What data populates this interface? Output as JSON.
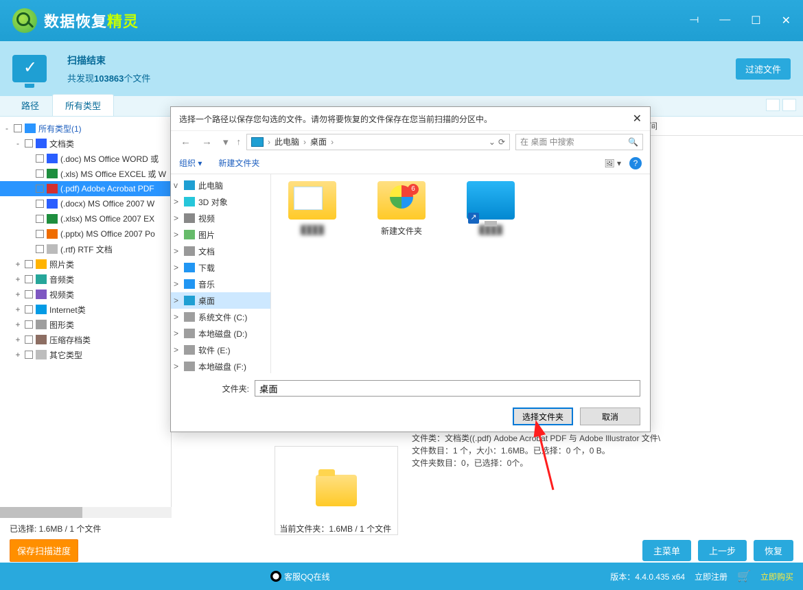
{
  "app": {
    "name_main": "数据恢复",
    "name_accent": "精灵"
  },
  "winctrls": {
    "opt": "⟞",
    "min": "—",
    "max": "☐",
    "close": "✕"
  },
  "scan": {
    "title": "扫描结束",
    "subtitle_prefix": "共发现",
    "count": "103863",
    "subtitle_suffix": "个文件",
    "filter_btn": "过滤文件"
  },
  "tabs": {
    "path": "路径",
    "all": "所有类型"
  },
  "tree": [
    {
      "ind": 0,
      "tw": "-",
      "ic": "ic-all",
      "label": "所有类型(1)",
      "blue": true
    },
    {
      "ind": 1,
      "tw": "-",
      "ic": "ic-docs",
      "label": "文档类"
    },
    {
      "ind": 2,
      "tw": "",
      "ic": "ic-doc",
      "label": "(.doc) MS Office WORD 或"
    },
    {
      "ind": 2,
      "tw": "",
      "ic": "ic-xls",
      "label": "(.xls) MS Office EXCEL 或 W"
    },
    {
      "ind": 2,
      "tw": "",
      "ic": "ic-pdf",
      "label": "(.pdf) Adobe Acrobat PDF",
      "sel": true
    },
    {
      "ind": 2,
      "tw": "",
      "ic": "ic-doc",
      "label": "(.docx) MS Office 2007 W"
    },
    {
      "ind": 2,
      "tw": "",
      "ic": "ic-xls",
      "label": "(.xlsx) MS Office 2007 EX"
    },
    {
      "ind": 2,
      "tw": "",
      "ic": "ic-ppt",
      "label": "(.pptx) MS Office 2007 Po"
    },
    {
      "ind": 2,
      "tw": "",
      "ic": "ic-rtf",
      "label": "(.rtf) RTF 文档"
    },
    {
      "ind": 1,
      "tw": "+",
      "ic": "ic-photo",
      "label": "照片类"
    },
    {
      "ind": 1,
      "tw": "+",
      "ic": "ic-audio",
      "label": "音频类"
    },
    {
      "ind": 1,
      "tw": "+",
      "ic": "ic-video",
      "label": "视频类"
    },
    {
      "ind": 1,
      "tw": "+",
      "ic": "ic-net",
      "label": "Internet类"
    },
    {
      "ind": 1,
      "tw": "+",
      "ic": "ic-graph",
      "label": "图形类"
    },
    {
      "ind": 1,
      "tw": "+",
      "ic": "ic-zip",
      "label": "压缩存档类"
    },
    {
      "ind": 1,
      "tw": "+",
      "ic": "ic-other",
      "label": "其它类型"
    }
  ],
  "content_header": {
    "mod": "修改时间"
  },
  "info": {
    "l1": "文件类：文档类((.pdf) Adobe Acrobat PDF 与 Adobe Illustrator 文件\\",
    "l2": "文件数目：1 个，大小：1.6MB。已选择：0 个，0 B。",
    "l3": "文件夹数目：0，已选择：0个。"
  },
  "footer": {
    "selected": "已选择: 1.6MB / 1 个文件",
    "current": "当前文件夹：1.6MB / 1 个文件",
    "save_scan": "保存扫描进度",
    "main_menu": "主菜单",
    "prev": "上一步",
    "recover": "恢复"
  },
  "status2": {
    "qq": "客服QQ在线",
    "version_label": "版本：",
    "version": "4.4.0.435 x64",
    "register": "立即注册",
    "buy": "立即购买"
  },
  "dialog": {
    "title": "选择一个路径以保存您勾选的文件。请勿将要恢复的文件保存在您当前扫描的分区中。",
    "crumb": {
      "pc": "此电脑",
      "desktop": "桌面"
    },
    "search_placeholder": "在 桌面 中搜索",
    "toolbar": {
      "org": "组织 ▾",
      "newf": "新建文件夹"
    },
    "nav_tree": [
      {
        "tw": "v",
        "ic": "dic-pc",
        "label": "此电脑"
      },
      {
        "tw": ">",
        "ic": "dic-3d",
        "label": "3D 对象"
      },
      {
        "tw": ">",
        "ic": "dic-vid",
        "label": "视频"
      },
      {
        "tw": ">",
        "ic": "dic-pic",
        "label": "图片"
      },
      {
        "tw": ">",
        "ic": "dic-doc",
        "label": "文档"
      },
      {
        "tw": ">",
        "ic": "dic-dl",
        "label": "下载"
      },
      {
        "tw": ">",
        "ic": "dic-mus",
        "label": "音乐"
      },
      {
        "tw": ">",
        "ic": "dic-desk",
        "label": "桌面",
        "sel": true
      },
      {
        "tw": ">",
        "ic": "dic-disk",
        "label": "系统文件 (C:)"
      },
      {
        "tw": ">",
        "ic": "dic-disk",
        "label": "本地磁盘 (D:)"
      },
      {
        "tw": ">",
        "ic": "dic-disk",
        "label": "软件 (E:)"
      },
      {
        "tw": ">",
        "ic": "dic-disk",
        "label": "本地磁盘 (F:)"
      }
    ],
    "files": [
      {
        "type": "folder-open",
        "label": "",
        "blur": true
      },
      {
        "type": "folder-multi",
        "label": "新建文件夹",
        "badge": "6"
      },
      {
        "type": "monitor",
        "label": "",
        "blur": true
      }
    ],
    "folder_label": "文件夹:",
    "folder_value": "桌面",
    "btn_select": "选择文件夹",
    "btn_cancel": "取消"
  }
}
